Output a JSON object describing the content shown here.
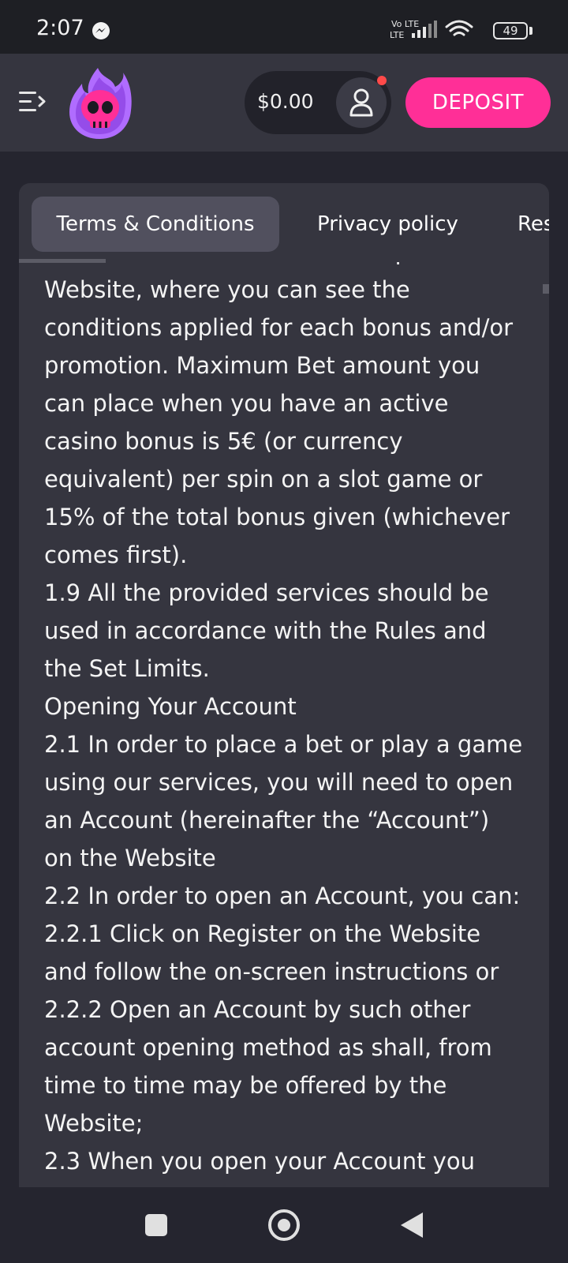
{
  "status_bar": {
    "time": "2:07",
    "network": "Vo LTE",
    "battery": "49",
    "icons": [
      "messenger-icon",
      "volte-icon",
      "signal-icon",
      "wifi-icon",
      "battery-icon"
    ]
  },
  "header": {
    "balance": "$0.00",
    "deposit_label": "DEPOSIT",
    "colors": {
      "accent": "#ff2f97",
      "logo_flame": "#b06cff",
      "logo_skull": "#ff2f97"
    }
  },
  "tabs": [
    {
      "label": "Terms & Conditions",
      "active": true
    },
    {
      "label": "Privacy policy",
      "active": false
    },
    {
      "label": "Res",
      "active": false
    }
  ],
  "document": {
    "lines": [
      "described in the “Promotions” part of the",
      "Website, where you can see the",
      "conditions applied for each bonus and/or",
      "promotion. Maximum Bet amount you",
      "can place when you have an active",
      "casino bonus is 5€ (or currency",
      "equivalent) per spin on a slot game or",
      "15% of the total bonus given (whichever",
      "comes first).",
      "1.9 All the provided services should be",
      "used in accordance with the Rules and",
      "the Set Limits.",
      "Opening Your Account",
      "2.1 In order to place a bet or play a game",
      "using our services, you will need to open",
      "an Account (hereinafter the “Account”)",
      "on the Website",
      "2.2 In order to open an Account, you can:",
      "2.2.1 Click on Register on the Website",
      "and follow the on-screen instructions or",
      "2.2.2 Open an Account by such other",
      "account opening method as shall, from",
      "time to time may be offered by the",
      "Website;",
      "2.3 When you open your Account you"
    ]
  },
  "nav_bar": {
    "icons": [
      "recents-icon",
      "home-icon",
      "back-icon"
    ]
  }
}
